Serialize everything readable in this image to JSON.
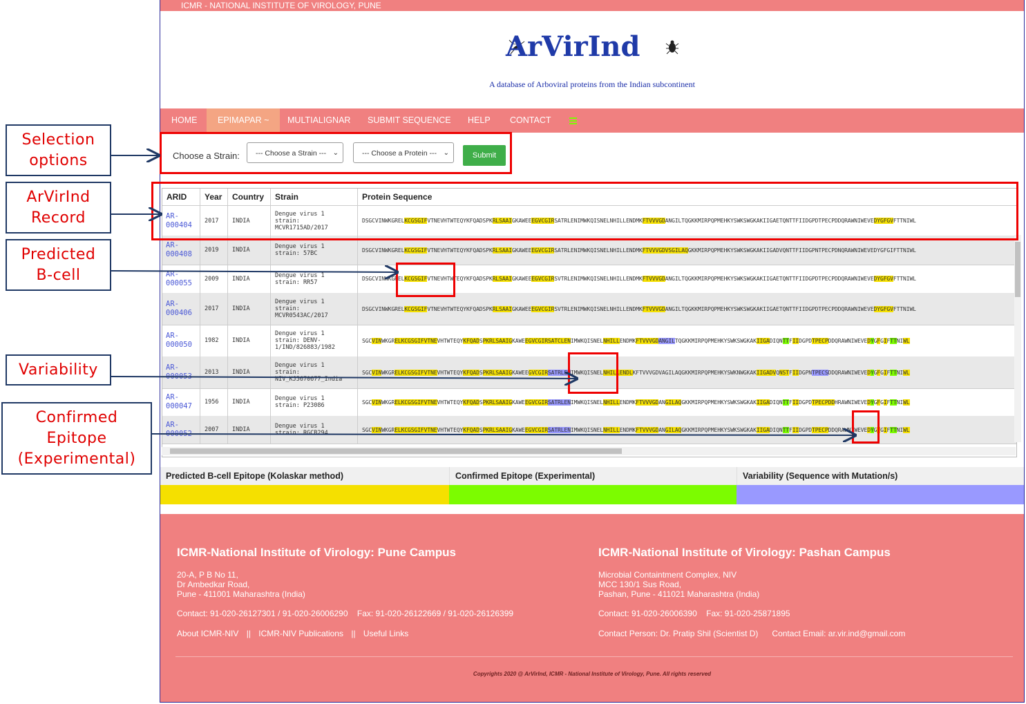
{
  "site": {
    "topbar": "ICMR - NATIONAL INSTITUTE OF VIROLOGY, PUNE",
    "logo": "ArVirInd",
    "tagline": "A database of Arboviral proteins from the Indian subcontinent"
  },
  "nav": [
    {
      "label": "HOME"
    },
    {
      "label": "EPIMAPAR ~"
    },
    {
      "label": "MULTIALIGNAR"
    },
    {
      "label": "SUBMIT SEQUENCE"
    },
    {
      "label": "HELP"
    },
    {
      "label": "CONTACT"
    }
  ],
  "selection": {
    "label": "Choose a Strain:",
    "strain_dropdown": "--- Choose a Strain ---",
    "protein_dropdown": "--- Choose a Protein ---",
    "submit": "Submit"
  },
  "table": {
    "headers": [
      "ARID",
      "Year",
      "Country",
      "Strain",
      "Protein Sequence"
    ],
    "rows": [
      {
        "arid": "AR-\n000404",
        "year": "2017",
        "country": "INDIA",
        "strain": "Dengue virus 1\nstrain:\nMCVR1715AD/2017",
        "seq": "DSGCVINWKGREL[y:KCGSGIF]VTNEVHTWTEQYKFQADSPK[y:RLSAAI]GKAWEE[y:EGVCGIR]SATRLENIMWKQISNELNHILLENDMK[y:FTVVVGD]ANGILTQGKKMIRPQPMEHKYSWKSWGKAKIIGAETQNTTFIIDGPDTPECPDDQRAWNIWEVE[y:DYGFGV]FTTNIWL"
      },
      {
        "arid": "AR-\n000408",
        "year": "2019",
        "country": "INDIA",
        "strain": "Dengue virus 1\nstrain: 57BC",
        "seq": "DSGCVINWKGREL[y:KCGSGIF]VTNEVHTWTEQYKFQADSPK[y:RLSAAI]GKAWEE[y:EGVCGIR]SATRLENIMWKQISNELNHILLENDMK[y:FTVVVGDVSGILAQ]GKKMIRPQPMEHKYSWKSWGKAKIIGADVQNTTFIIDGPNTPECPDNQRAWNIWEVEDYGFGIFTTNIWL"
      },
      {
        "arid": "AR-\n000055",
        "year": "2009",
        "country": "INDIA",
        "strain": "Dengue virus 1\nstrain: RR57",
        "seq": "DSGCVINWKGREL[y:KCGSGIF]VTNEVHTWTEQYKFQADSPK[y:RLSAAI]GKAWEE[y:EGVCGIR]SVTRLENIMWKQISNELNHILLENDMK[y:FTVVVGD]ANGILTQGKKMIRPQPMEHKYSWKSWGKAKIIGAETQNTTFIIDGPDTPECPDDQRAWNIWEVE[y:DYGFGV]FTTNIWL"
      },
      {
        "arid": "AR-\n000406",
        "year": "2017",
        "country": "INDIA",
        "strain": "Dengue virus 1\nstrain:\nMCVR0543AC/2017",
        "seq": "DSGCVINWKGREL[y:KCGSGIF]VTNEVHTWTEQYKFQADSPK[y:RLSAAI]GKAWEE[y:EGVCGIR]SVTRLENIMWKQISNELNHILLENDMK[y:FTVVVGD]ANGILTQGKKMIRPQPMEHKYSWKSWGKAKIIGAETQNTTFIIDGPDTPECPDDQRAWNIWEVE[y:DYGFGV]FTTNIWL"
      },
      {
        "arid": "AR-\n000050",
        "year": "1982",
        "country": "INDIA",
        "strain": "Dengue virus 1\nstrain: DENV-\n1/IND/826883/1982",
        "seq": "SGC[y:VIN]WKGR[y:ELKCGSGIFVTNE]VHTWTEQY[y:KFQAD]S[y:PKRLSAAIG]KAWE[y:EGVCGIRSATCLEN]IMWKQISNEL[y:NHILL]ENDMK[y:FTVVVGD][p:ANGIL]TQGKKMIRPQPMEHKYSWKSWGKAK[y:IIGA]DIQN[g:TT]F[y:II]DGPD[y:TPECP]DDQRAWNIWEVE[y:D][g:Y]G[y:F]G[y:I]F[g:TT]NI[y:WL]"
      },
      {
        "arid": "AR-\n000053",
        "year": "2013",
        "country": "INDIA",
        "strain": "Dengue virus 1\nstrain:\nNIV_KJ5670677_India",
        "seq": "SGC[y:VIN]WKGR[y:ELKCGSGIFVTNE]VHTWTEQY[y:KFQAD]S[y:PKRLSAAIG]KAWEE[y:GVCGIR][p:SATRLEN]IMWKQISNEL[y:NHILLENDL]KFTVVVGDVAGILAQGKKMIRPQPMEHKYSWKNWGKAK[y:IIGADV]Q[y:NST]F[y:II]DGPN[p:TPECS]DDQRAWNIWEVE[y:D][g:Y]G[y:F]G[y:I]F[g:TT]NI[y:WL]"
      },
      {
        "arid": "AR-\n000047",
        "year": "1956",
        "country": "INDIA",
        "strain": "Dengue virus 1\nstrain: P23086",
        "seq": "SGC[y:VIN]WKGR[y:ELKCGSGIFVTNE]VHTWTEQY[y:KFQAD]S[y:PKRLSAAIG]KAWE[y:EGVCGIR][p:SATRLEN]IMWKQISNEL[y:NHILL]ENDMK[y:FTVVVGD]AN[y:GILAQ]GKKMIRPQPMEHKYSWKSWGKAK[y:IIGA]DIQN[g:TT]F[y:II]DGPD[y:TPECPDD]HRAWNIWEVE[y:D][g:Y]G[y:F]G[y:I]F[g:TT]NI[y:WL]"
      },
      {
        "arid": "AR-\n000052",
        "year": "2007",
        "country": "INDIA",
        "strain": "Dengue virus 1\nstrain: RGCB294",
        "seq": "SGC[y:VIN]WKGR[y:ELKCGSGIFVTNE]VHTWTEQY[y:KFQAD]S[y:PKRLSAAIG]KAWE[y:EGVCGIR][p:SATRLEN]IMWKQISNEL[y:NHILL]ENDMK[y:FTVVVGD]AN[y:GILAQ]GKKMIRPQPMEHKYSWKSWGKAK[y:IIGA]DIQN[g:TT]F[y:II]DGPD[y:TPECP]DDQRAWNIWEVE[y:D][g:Y]G[y:F]G[y:I]F[g:TT]NI[y:WL]"
      }
    ]
  },
  "legend": [
    {
      "label": "Predicted B-cell Epitope (Kolaskar method)",
      "color": "#f5e000"
    },
    {
      "label": "Confirmed Epitope (Experimental)",
      "color": "#7cfc00"
    },
    {
      "label": "Variability (Sequence with Mutation/s)",
      "color": "#9999ff"
    }
  ],
  "footer": {
    "pune": {
      "title": "ICMR-National Institute of Virology: Pune Campus",
      "address": "20-A, P B No 11,\nDr Ambedkar Road,\nPune - 411001 Maharashtra (India)",
      "contact": "Contact: 91-020-26127301 / 91-020-26006290    Fax: 91-020-26122669 / 91-020-26126399",
      "links": [
        "About ICMR-NIV",
        "ICMR-NIV Publications",
        "Useful Links"
      ],
      "separator": "||"
    },
    "pashan": {
      "title": "ICMR-National Institute of Virology: Pashan Campus",
      "address": "Microbial Containtment Complex, NIV\nMCC 130/1 Sus Road,\nPashan, Pune - 411021 Maharashtra (India)",
      "contact": "Contact: 91-020-26006390    Fax: 91-020-25871895",
      "person": "Contact Person: Dr. Pratip Shil (Scientist D)      Contact Email: ar.vir.ind@gmail.com"
    },
    "copyright": "Copyrights 2020 @ ArVirInd, ICMR - National Institute of Virology, Pune. All rights reserved"
  },
  "annotations": [
    {
      "label": "Selection\noptions"
    },
    {
      "label": "ArVirInd\nRecord"
    },
    {
      "label": "Predicted\nB-cell"
    },
    {
      "label": "Variability"
    },
    {
      "label": "Confirmed\nEpitope\n(Experimental)"
    }
  ],
  "colors": {
    "nav": "#f08080",
    "active_nav": "#f4a583",
    "submit": "#3fae49",
    "logo": "#1f3aa8",
    "annotation_text": "#e00000",
    "box": "#ee0000"
  }
}
